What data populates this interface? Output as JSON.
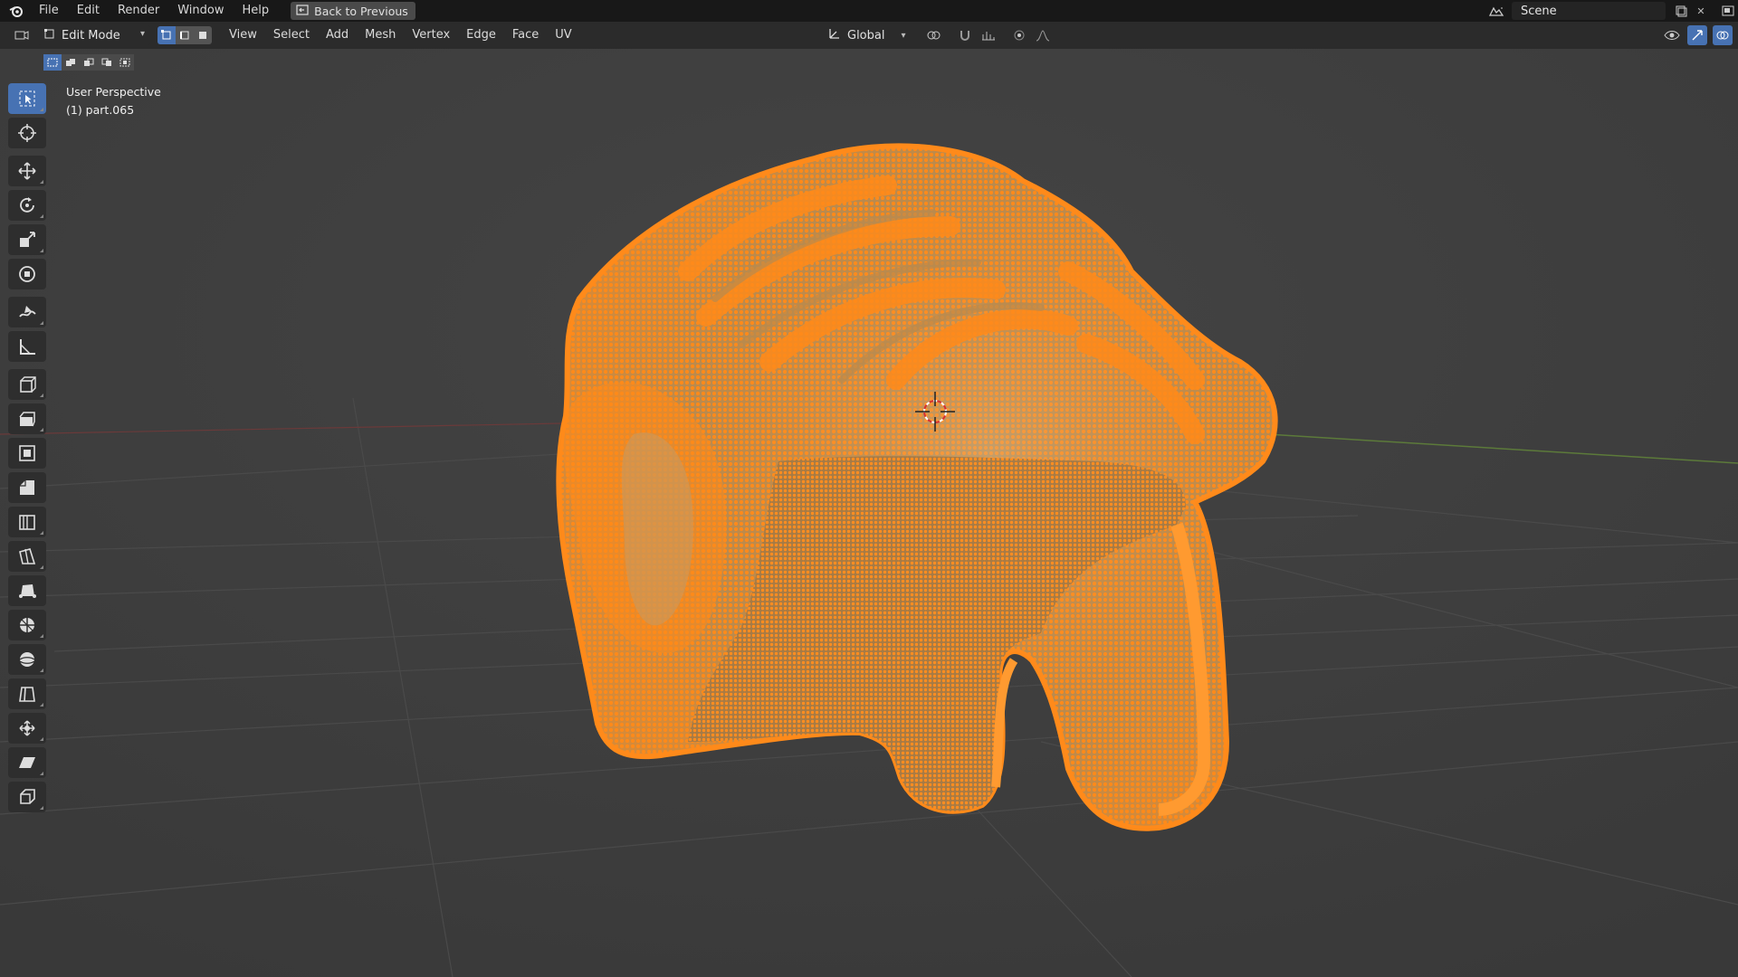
{
  "topbar": {
    "menu": [
      "File",
      "Edit",
      "Render",
      "Window",
      "Help"
    ],
    "back_button": "Back to Previous",
    "scene_name": "Scene"
  },
  "header": {
    "mode": "Edit Mode",
    "menus": [
      "View",
      "Select",
      "Add",
      "Mesh",
      "Vertex",
      "Edge",
      "Face",
      "UV"
    ],
    "transform_orientation": "Global"
  },
  "viewport": {
    "view_name": "User Perspective",
    "object_label": "(1) part.065"
  },
  "colors": {
    "selection_orange": "#ff8a1a",
    "active_blue": "#4772b3",
    "viewport_bg": "#3d3d3d"
  },
  "toolbar": {
    "tools": [
      "select-box",
      "cursor",
      "move",
      "rotate",
      "scale",
      "transform",
      "annotate",
      "measure",
      "add-cube",
      "extrude-region",
      "inset-faces",
      "bevel",
      "loop-cut",
      "knife",
      "poly-build",
      "spin",
      "smooth",
      "edge-slide",
      "shrink-fatten",
      "shear",
      "rip-region"
    ]
  }
}
